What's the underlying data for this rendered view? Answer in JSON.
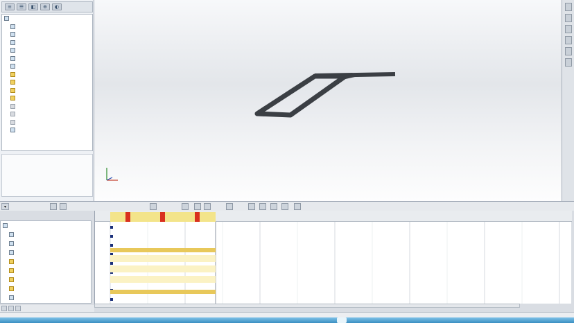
{
  "window": {
    "title": ""
  },
  "left_toolbar": {
    "buttons": [
      "feature-manager",
      "property-manager",
      "configuration-manager",
      "dimxpert-manager",
      "display-manager"
    ]
  },
  "feature_tree": {
    "items": [
      {
        "label": "",
        "icon": "assembly-icon",
        "style": ""
      },
      {
        "label": "",
        "icon": "annotations-icon",
        "style": ""
      },
      {
        "label": "",
        "icon": "folder-icon",
        "style": ""
      },
      {
        "label": "",
        "icon": "plane-icon",
        "style": ""
      },
      {
        "label": "",
        "icon": "plane-icon",
        "style": ""
      },
      {
        "label": "",
        "icon": "plane-icon",
        "style": ""
      },
      {
        "label": "",
        "icon": "origin-icon",
        "style": ""
      },
      {
        "label": "",
        "icon": "part-icon",
        "style": "yellow"
      },
      {
        "label": "",
        "icon": "part-icon",
        "style": "yellow"
      },
      {
        "label": "",
        "icon": "part-icon",
        "style": "yellow"
      },
      {
        "label": "",
        "icon": "part-icon",
        "style": "yellow"
      },
      {
        "label": "",
        "icon": "mate-icon",
        "style": "dim"
      },
      {
        "label": "",
        "icon": "mate-icon",
        "style": "dim"
      },
      {
        "label": "",
        "icon": "mate-icon",
        "style": "dim"
      },
      {
        "label": "",
        "icon": "mates-folder-icon",
        "style": ""
      }
    ]
  },
  "motion_tree": {
    "items": [
      {
        "label": "",
        "icon": "motion-study-icon",
        "style": ""
      },
      {
        "label": "",
        "icon": "orientation-icon",
        "style": ""
      },
      {
        "label": "",
        "icon": "lights-cameras-icon",
        "style": ""
      },
      {
        "label": "",
        "icon": "origin-icon",
        "style": ""
      },
      {
        "label": "",
        "icon": "part-icon",
        "style": "yellow"
      },
      {
        "label": "",
        "icon": "part-icon",
        "style": "yellow"
      },
      {
        "label": "",
        "icon": "part-icon",
        "style": "yellow"
      },
      {
        "label": "",
        "icon": "part-icon",
        "style": "yellow"
      },
      {
        "label": "",
        "icon": "mates-folder-icon",
        "style": ""
      }
    ]
  },
  "timeline": {
    "tick_labels": [
      "",
      "",
      "",
      "",
      "",
      "",
      "",
      "",
      "",
      "",
      "",
      "",
      ""
    ],
    "keyframes": [
      0,
      1,
      2
    ],
    "accent": "#e8c85a",
    "marker_color": "#d9301e"
  },
  "bottom_tabs": [
    "",
    "",
    ""
  ],
  "status": {
    "text": ""
  },
  "colors": {
    "model": "#3b3f44",
    "highlight": "#f3e48a"
  }
}
